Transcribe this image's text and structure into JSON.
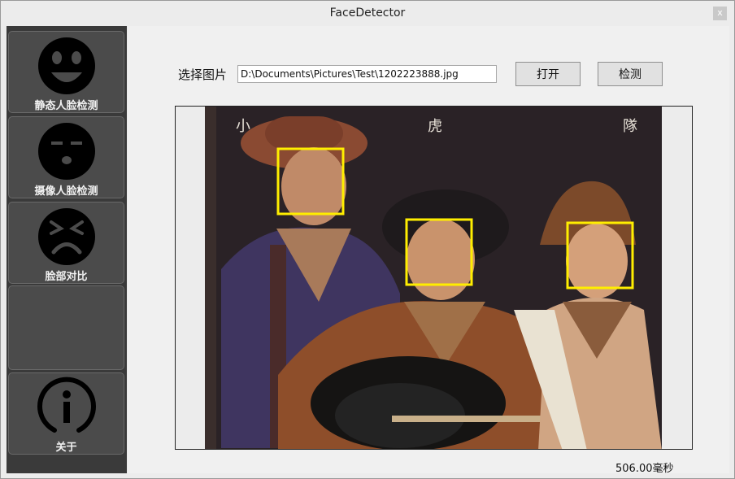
{
  "window": {
    "title": "FaceDetector",
    "close_label": "x"
  },
  "sidebar": {
    "items": [
      {
        "label": "静态人脸检测",
        "icon": "smiling-face-icon"
      },
      {
        "label": "摄像人脸检测",
        "icon": "sleepy-face-icon"
      },
      {
        "label": "脸部对比",
        "icon": "frowning-face-icon"
      },
      {
        "label": "",
        "icon": ""
      },
      {
        "label": "关于",
        "icon": "info-icon"
      }
    ]
  },
  "main": {
    "file_label": "选择图片",
    "file_path": "D:\\Documents\\Pictures\\Test\\1202223888.jpg",
    "open_button": "打开",
    "detect_button": "检测",
    "photo_caption": [
      "小",
      "虎",
      "隊"
    ],
    "detected_faces": 3,
    "status_time": "506.00毫秒"
  },
  "colors": {
    "sidebar_bg": "#3a3a3a",
    "nav_item_bg": "#4b4b4b",
    "face_box": "#ffee00",
    "photo_bg": "#2a2226"
  }
}
